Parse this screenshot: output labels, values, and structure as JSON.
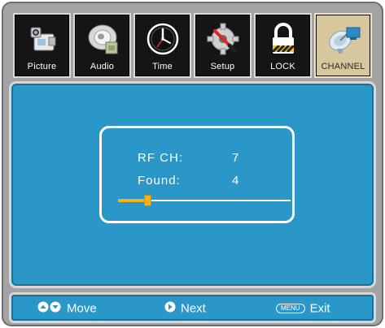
{
  "tabs": [
    {
      "label": "Picture",
      "icon": "camcorder-icon",
      "active": false
    },
    {
      "label": "Audio",
      "icon": "speaker-disc-icon",
      "active": false
    },
    {
      "label": "Time",
      "icon": "clock-icon",
      "active": false
    },
    {
      "label": "Setup",
      "icon": "gear-wrench-icon",
      "active": false
    },
    {
      "label": "LOCK",
      "icon": "padlock-icon",
      "active": false
    },
    {
      "label": "CHANNEL",
      "icon": "satellite-dish-icon",
      "active": true
    }
  ],
  "scan": {
    "rf_ch_label": "RF CH:",
    "rf_ch_value": "7",
    "found_label": "Found:",
    "found_value": "4",
    "progress_fraction": 0.17
  },
  "help": {
    "move_label": "Move",
    "next_label": "Next",
    "menu_key_label": "MENU",
    "exit_label": "Exit"
  },
  "colors": {
    "panel_blue": "#2b96c8",
    "progress_yellow": "#f3b41b",
    "active_tab": "#d8c79c"
  }
}
